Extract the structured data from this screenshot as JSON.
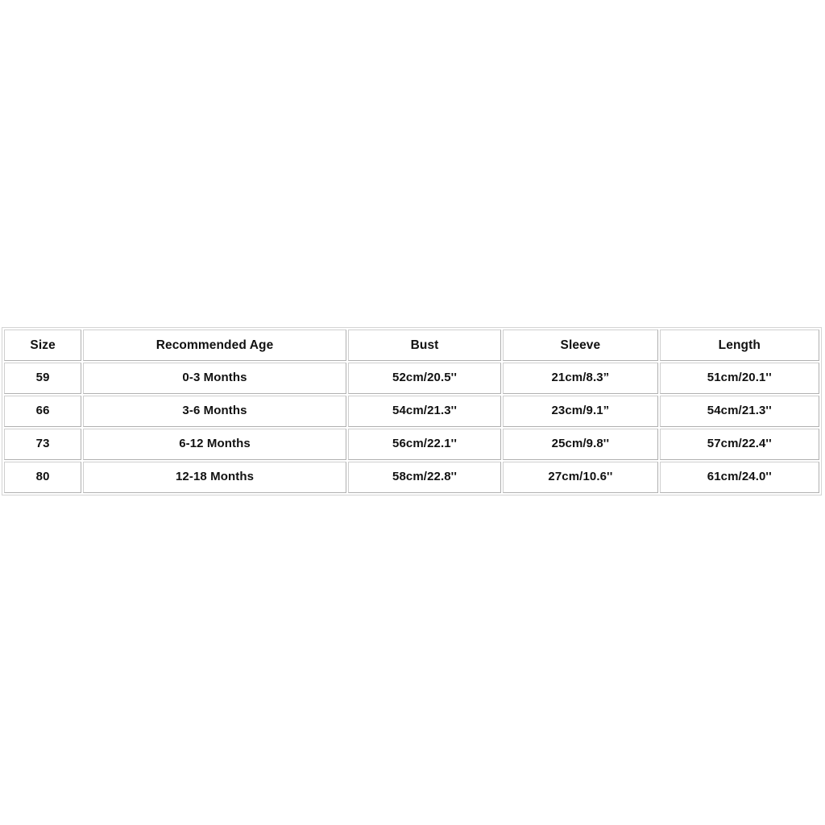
{
  "page": {
    "background_color": "#ffffff",
    "text_color": "#111111",
    "border_color": "#bdbdbd",
    "outer_border_color": "#d4d4d4"
  },
  "table": {
    "columns": [
      {
        "key": "size",
        "label": "Size"
      },
      {
        "key": "age",
        "label": "Recommended Age"
      },
      {
        "key": "bust",
        "label": "Bust"
      },
      {
        "key": "sleeve",
        "label": "Sleeve"
      },
      {
        "key": "length",
        "label": "Length"
      }
    ],
    "rows": [
      {
        "size": "59",
        "age": "0-3 Months",
        "bust": "52cm/20.5''",
        "sleeve": "21cm/8.3”",
        "length": "51cm/20.1''"
      },
      {
        "size": "66",
        "age": "3-6 Months",
        "bust": "54cm/21.3''",
        "sleeve": "23cm/9.1”",
        "length": "54cm/21.3''"
      },
      {
        "size": "73",
        "age": "6-12 Months",
        "bust": "56cm/22.1''",
        "sleeve": "25cm/9.8''",
        "length": "57cm/22.4''"
      },
      {
        "size": "80",
        "age": "12-18 Months",
        "bust": "58cm/22.8''",
        "sleeve": "27cm/10.6''",
        "length": "61cm/24.0''"
      }
    ]
  }
}
